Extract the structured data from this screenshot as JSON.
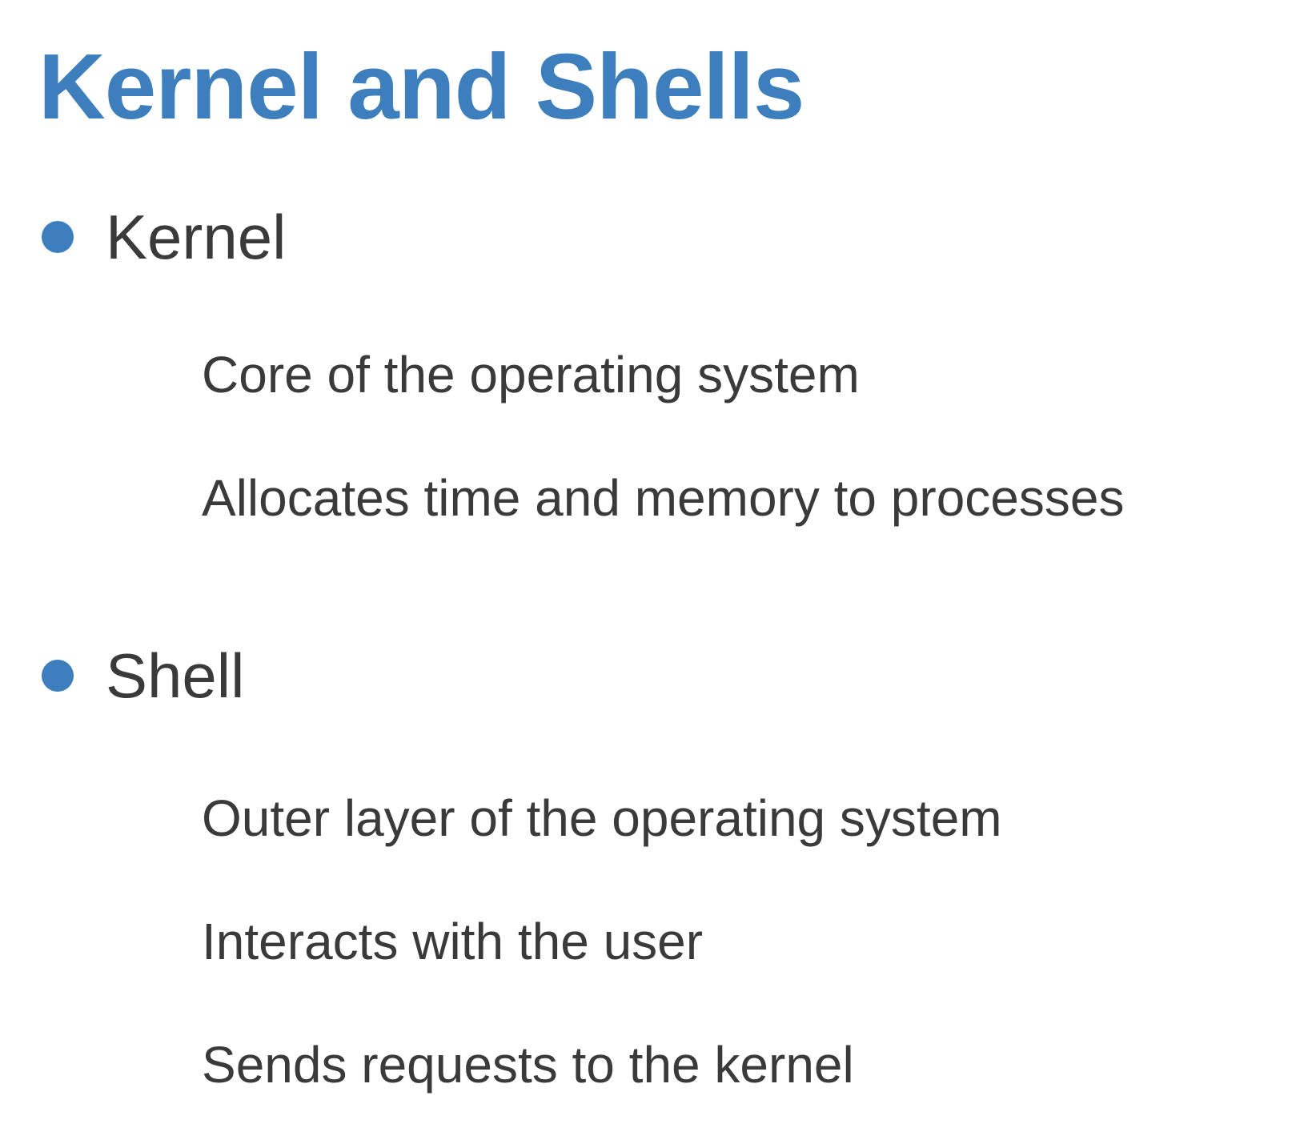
{
  "slide": {
    "title": "Kernel and Shells",
    "accent_color": "#3d7fbd",
    "text_color": "#3a3a3a",
    "sections": [
      {
        "heading": "Kernel",
        "points": [
          "Core of the operating system",
          "Allocates time and memory to processes"
        ]
      },
      {
        "heading": "Shell",
        "points": [
          "Outer layer of the operating system",
          "Interacts with the user",
          "Sends requests to the kernel"
        ]
      }
    ]
  }
}
